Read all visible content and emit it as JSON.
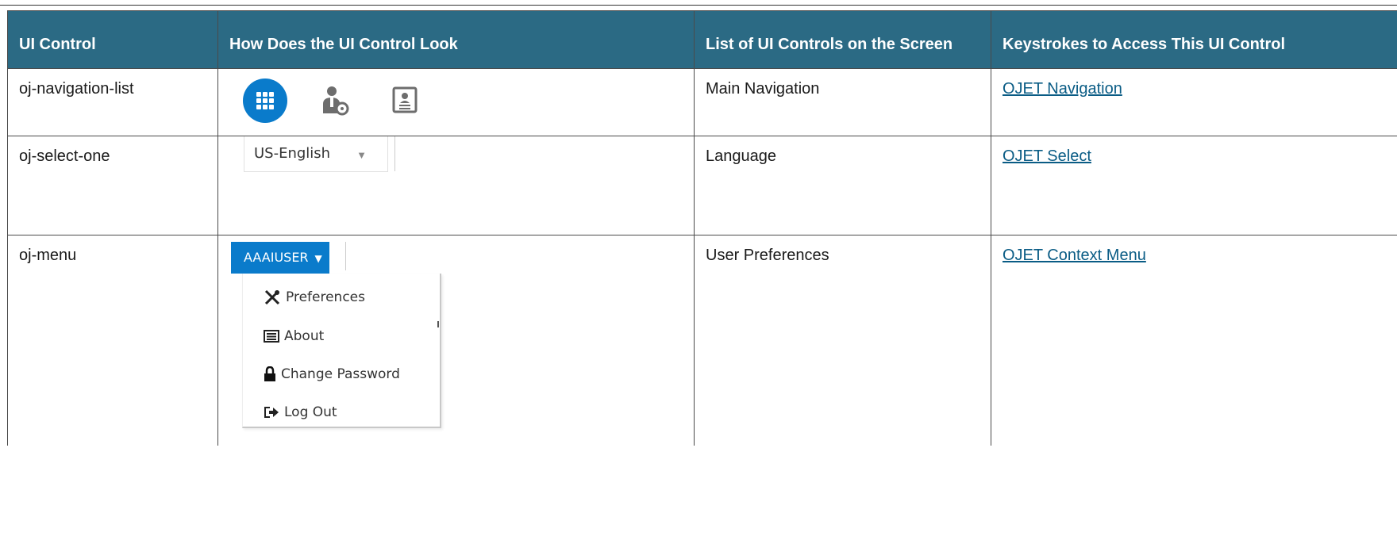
{
  "table": {
    "headers": [
      "UI Control",
      "How Does the UI Control Look",
      "List of UI Controls on the Screen",
      "Keystrokes to Access This UI Control"
    ],
    "rows": [
      {
        "control": "oj-navigation-list",
        "list": "Main Navigation",
        "keystrokes_link": "OJET Navigation",
        "illustration": {
          "icons": [
            "apps-grid-icon",
            "user-settings-icon",
            "contact-card-icon"
          ],
          "accent": "#0a7bcb"
        }
      },
      {
        "control": "oj-select-one",
        "list": "Language",
        "keystrokes_link": "OJET Select",
        "illustration": {
          "selected_value": "US-English"
        }
      },
      {
        "control": "oj-menu",
        "list": "User Preferences",
        "keystrokes_link": "OJET Context Menu",
        "illustration": {
          "button_label": "AAAIUSER",
          "menu_items": [
            "Preferences",
            "About",
            "Change Password",
            "Log Out"
          ]
        }
      }
    ]
  },
  "colors": {
    "header_bg": "#2b6a84",
    "link": "#0a5c85",
    "accent": "#0a7bcb"
  }
}
